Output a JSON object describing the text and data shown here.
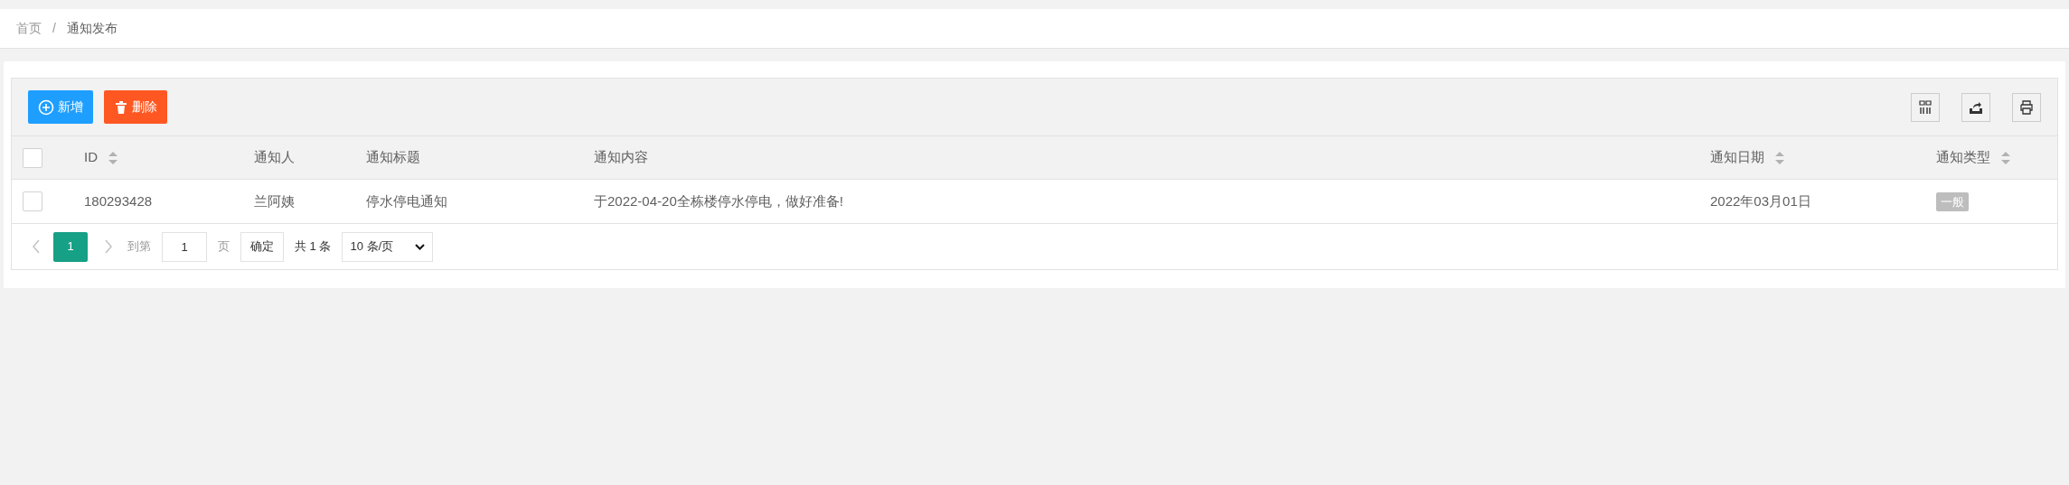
{
  "breadcrumb": [
    {
      "label": "首页",
      "current": false
    },
    {
      "label": "通知发布",
      "current": true
    }
  ],
  "breadcrumb_separator": "/",
  "toolbar": {
    "buttons": [
      {
        "label": "新增",
        "kind": "add"
      },
      {
        "label": "删除",
        "kind": "delete"
      }
    ]
  },
  "table": {
    "columns": [
      {
        "label": "ID",
        "kind": "sortable"
      },
      {
        "label": "通知人",
        "kind": "plain"
      },
      {
        "label": "通知标题",
        "kind": "plain"
      },
      {
        "label": "通知内容",
        "kind": "plain"
      },
      {
        "label": "通知日期",
        "kind": "sortable"
      },
      {
        "label": "通知类型",
        "kind": "sortable"
      }
    ],
    "header_checked": false,
    "rows": [
      {
        "checked": false,
        "cells": [
          "180293428",
          "兰阿姨",
          "停水停电通知",
          "于2022-04-20全栋楼停水停电，做好准备!",
          "2022年03月01日"
        ],
        "tag": "一般"
      }
    ]
  },
  "pagination": {
    "pages": [
      {
        "label": "1",
        "selected": true
      }
    ],
    "goto_label": "到第",
    "goto_value": "1",
    "page_unit": "页",
    "confirm": "确定",
    "total": "共 1 条",
    "page_size": "10 条/页"
  }
}
